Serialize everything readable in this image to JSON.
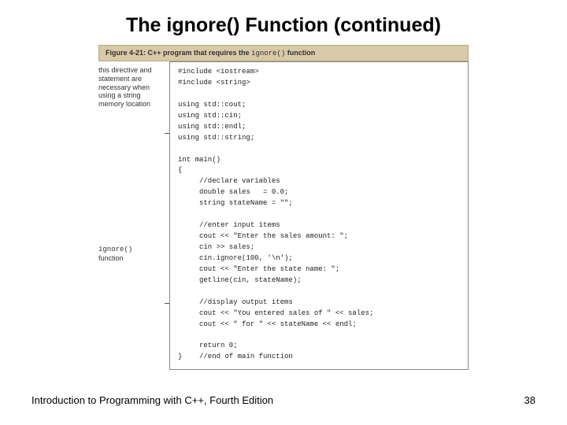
{
  "title": "The ignore() Function (continued)",
  "figure": {
    "caption_prefix": "Figure 4-21: C++ program that requires the ",
    "caption_code": "ignore()",
    "caption_suffix": " function",
    "annotation1": "this directive and statement are necessary when using a string memory location",
    "annotation2_line1": "ignore()",
    "annotation2_line2": "function",
    "code": "#include <iostream>\n#include <string>\n\nusing std::cout;\nusing std::cin;\nusing std::endl;\nusing std::string;\n\nint main()\n{\n     //declare variables\n     double sales   = 0.0;\n     string stateName = \"\";\n\n     //enter input items\n     cout << \"Enter the sales amount: \";\n     cin >> sales;\n     cin.ignore(100, '\\n');\n     cout << \"Enter the state name: \";\n     getline(cin, stateName);\n\n     //display output items\n     cout << \"You entered sales of \" << sales;\n     cout << \" for \" << stateName << endl;\n\n     return 0;\n}    //end of main function"
  },
  "footer_left": "Introduction to Programming with C++, Fourth Edition",
  "footer_right": "38"
}
